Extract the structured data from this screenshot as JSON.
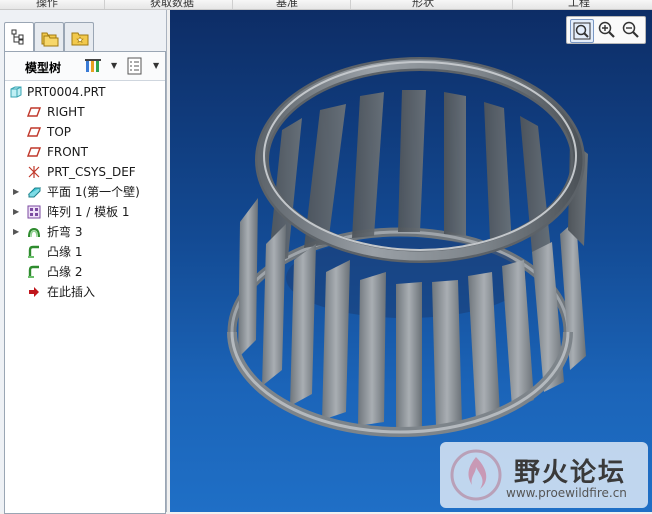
{
  "ribbon": {
    "groups": [
      "操作",
      "获取数据",
      "基准",
      "形状",
      "工程"
    ]
  },
  "tree": {
    "title": "模型树",
    "items": [
      {
        "label": "PRT0004.PRT",
        "icon": "part-icon",
        "expandable": false
      },
      {
        "label": "RIGHT",
        "icon": "datum-plane-icon",
        "expandable": false
      },
      {
        "label": "TOP",
        "icon": "datum-plane-icon",
        "expandable": false
      },
      {
        "label": "FRONT",
        "icon": "datum-plane-icon",
        "expandable": false
      },
      {
        "label": "PRT_CSYS_DEF",
        "icon": "csys-icon",
        "expandable": false
      },
      {
        "label": "平面 1(第一个壁)",
        "icon": "flat-wall-icon",
        "expandable": true
      },
      {
        "label": "阵列 1 / 模板 1",
        "icon": "pattern-icon",
        "expandable": true
      },
      {
        "label": "折弯 3",
        "icon": "bend-icon",
        "expandable": true
      },
      {
        "label": "凸缘 1",
        "icon": "flange-icon",
        "expandable": false
      },
      {
        "label": "凸缘 2",
        "icon": "flange-icon",
        "expandable": false
      },
      {
        "label": "在此插入",
        "icon": "insert-here-arrow-icon",
        "expandable": false
      }
    ]
  },
  "viewport": {
    "tools": [
      "zoom-fit-icon",
      "zoom-in-icon",
      "zoom-out-icon"
    ]
  },
  "watermark": {
    "title": "野火论坛",
    "url": "www.proewildfire.cn"
  },
  "colors": {
    "viewport_top": "#0d2d66",
    "viewport_bottom": "#1f6fc6",
    "model_steel": "#8c9298",
    "accent_cyan": "#3ec7d6",
    "insert_arrow": "#c0161c"
  }
}
